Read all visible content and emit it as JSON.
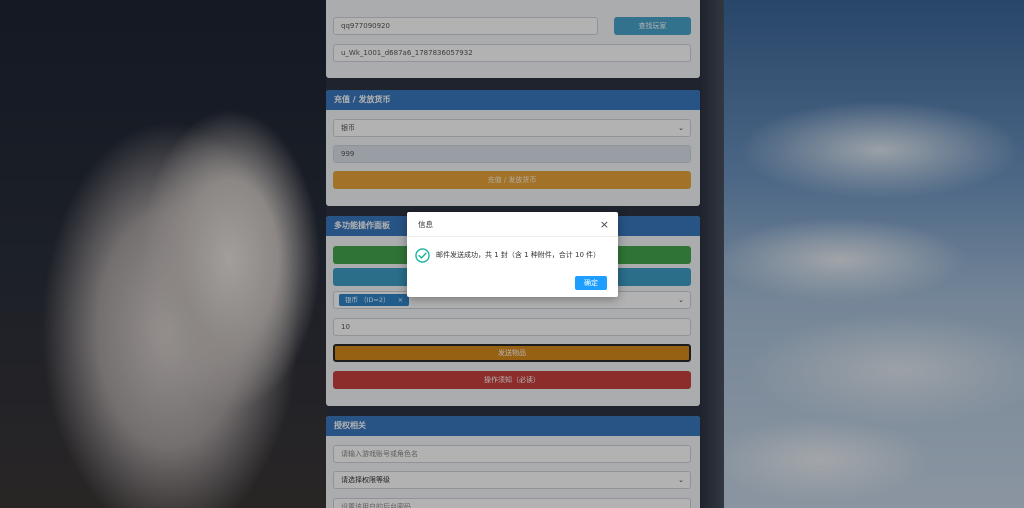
{
  "player_section": {
    "qq_value": "qq977090920",
    "search_label": "查找玩家",
    "uid_value": "u_Wk_1001_d687a6_1787836057932"
  },
  "recharge_section": {
    "title": "充值 / 发放货币",
    "currency_selected": "银币",
    "amount_value": "999",
    "submit_label": "充值 / 发放货币"
  },
  "multi_panel": {
    "title": "多功能操作面板",
    "item_tag": "银币 （ID=2）",
    "item_tag_remove": "×",
    "quantity_value": "10",
    "send_label": "发送物品",
    "notice_label": "操作须知（必读）"
  },
  "auth_section": {
    "title": "授权相关",
    "account_placeholder": "请输入游戏账号或角色名",
    "level_selected": "请选择权限等级",
    "password_placeholder": "设置该用户的后台密码"
  },
  "dialog": {
    "title": "信息",
    "close": "×",
    "message": "邮件发送成功，共 1 封（含 1 种附件，合计 10 件）",
    "confirm_label": "确定"
  },
  "colors": {
    "header_blue": "#3a78bf",
    "success_green": "#45a550",
    "info_cyan": "#3d9ec6",
    "warning_orange": "#e9a43a",
    "danger_red": "#c9403e",
    "dialog_button": "#1e9fff"
  }
}
